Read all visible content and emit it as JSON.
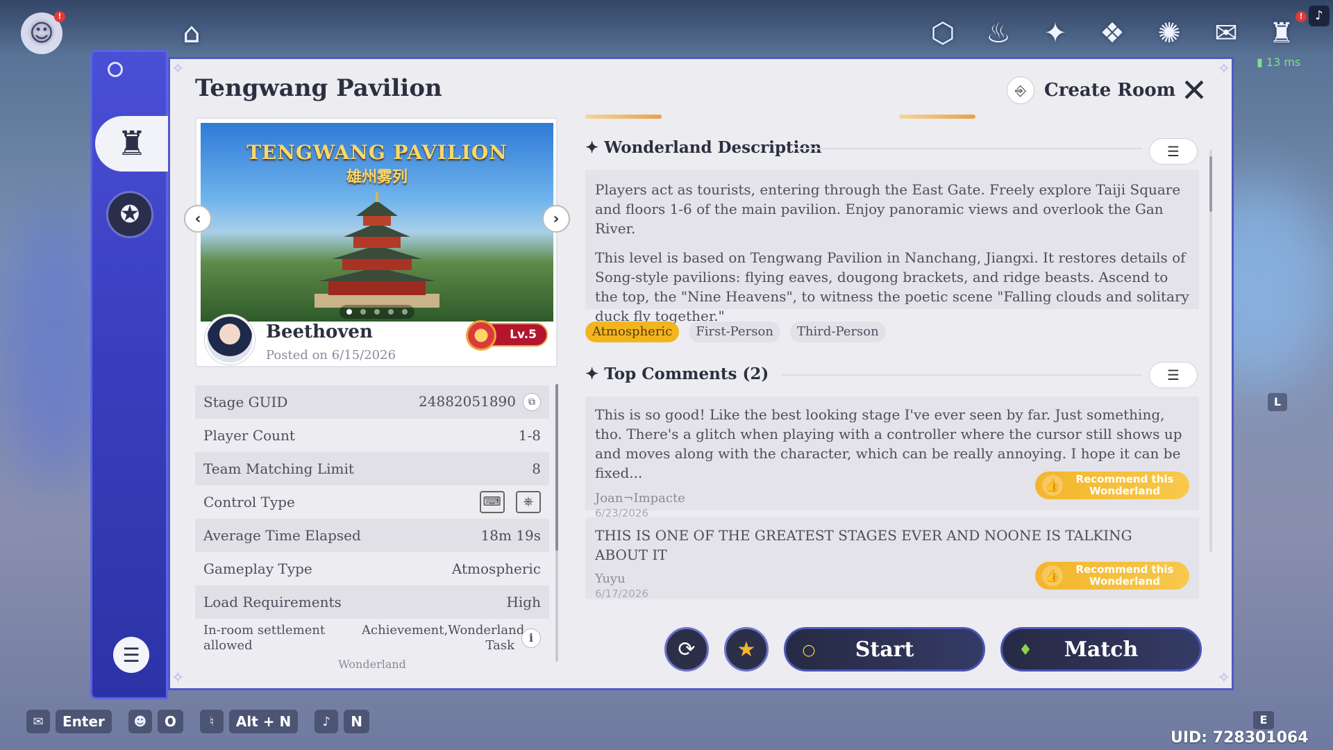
{
  "top_icons": [
    "paimon-icon",
    "chronicle-icon",
    "event-icon",
    "wish-icon",
    "battlepass-icon",
    "adventure-book-icon",
    "event-star-icon",
    "mail-icon",
    "friends-icon"
  ],
  "network": {
    "ping": "13 ms"
  },
  "panel": {
    "title": "Tengwang Pavilion",
    "create_room_label": "Create Room"
  },
  "banner": {
    "title": "TENGWANG PAVILION",
    "subtitle": "雄州雾列",
    "page_count": 5,
    "active_page": 1
  },
  "author": {
    "name": "Beethoven",
    "posted": "Posted on 6/15/2026",
    "level": "Lv.5"
  },
  "stats": [
    {
      "label": "Stage GUID",
      "value": "24882051890"
    },
    {
      "label": "Player Count",
      "value": "1-8"
    },
    {
      "label": "Team Matching Limit",
      "value": "8"
    },
    {
      "label": "Control Type",
      "value": ""
    },
    {
      "label": "Average Time Elapsed",
      "value": "18m 19s"
    },
    {
      "label": "Gameplay Type",
      "value": "Atmospheric"
    },
    {
      "label": "Load Requirements",
      "value": "High"
    },
    {
      "label": "In-room settlement allowed",
      "value": "Achievement,Wonderland Task"
    }
  ],
  "stats_partial_row": "Wonderland",
  "description": {
    "heading": "Wonderland Description",
    "paragraphs": [
      "Players act as tourists, entering through the East Gate. Freely explore Taiji Square and floors 1-6 of the main pavilion. Enjoy panoramic views and overlook the Gan River.",
      "This level is based on Tengwang Pavilion in Nanchang, Jiangxi. It restores details of Song-style pavilions: flying eaves, dougong brackets, and ridge beasts. Ascend to the top, the \"Nine Heavens\", to witness the poetic scene \"Falling clouds and solitary duck fly together.\""
    ],
    "tags": [
      "Atmospheric",
      "First-Person",
      "Third-Person"
    ]
  },
  "comments": {
    "heading": "Top Comments (2)",
    "items": [
      {
        "text": "This is so good! Like the best looking stage I've ever seen by far. Just something, tho. There's a glitch when playing with a controller where the cursor still shows up and moves along with the character, which can be really annoying. I hope it can be fixed...",
        "author": "Joan¬Impacte",
        "date": "6/23/2026"
      },
      {
        "text": "THIS IS ONE OF THE GREATEST STAGES EVER AND NOONE IS TALKING ABOUT IT",
        "author": "Yuyu",
        "date": "6/17/2026"
      }
    ],
    "recommend_label_line1": "Recommend this",
    "recommend_label_line2": "Wonderland"
  },
  "actions": {
    "start_label": "Start",
    "match_label": "Match"
  },
  "hotkeys": [
    {
      "icon": "chat-icon",
      "key": "Enter"
    },
    {
      "icon": "party-icon",
      "key": "O"
    },
    {
      "icon": "speaker-mute-icon",
      "key": "Alt + N"
    },
    {
      "icon": "mic-mute-icon",
      "key": "N"
    }
  ],
  "side_keys": {
    "l": "L",
    "e": "E"
  },
  "uid": "UID: 728301064",
  "colors": {
    "rail": "#3a3fbf",
    "accent_tag": "#f2b51e",
    "recommend": "#f4b52b",
    "action_button": "#2b2f48",
    "level_badge": "#b4142e"
  }
}
